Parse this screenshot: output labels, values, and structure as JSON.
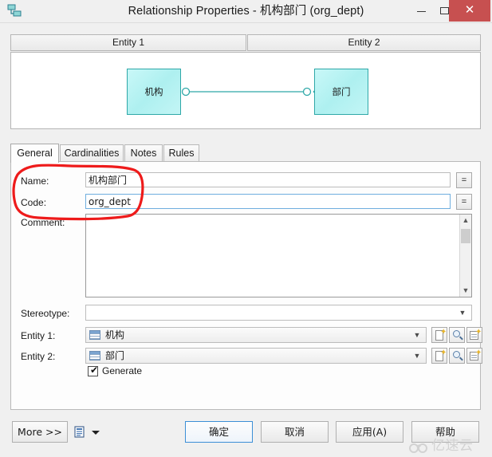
{
  "window": {
    "title": "Relationship Properties - 机构部门 (org_dept)",
    "app_icon": "relationship-icon",
    "minimize_label": "",
    "maximize_label": "",
    "close_label": "✕"
  },
  "preview": {
    "headers": [
      "Entity 1",
      "Entity 2"
    ],
    "entity1_label": "机构",
    "entity2_label": "部门",
    "entity_fill": "#aef0f0",
    "entity_border": "#2fa8a8",
    "link_color": "#2fa8a8"
  },
  "tabs": [
    {
      "label": "General",
      "active": true
    },
    {
      "label": "Cardinalities",
      "active": false
    },
    {
      "label": "Notes",
      "active": false
    },
    {
      "label": "Rules",
      "active": false
    }
  ],
  "form": {
    "name": {
      "label": "Name:",
      "value": "机构部门",
      "eq_label": "="
    },
    "code": {
      "label": "Code:",
      "value": "org_dept",
      "eq_label": "=",
      "focused": true
    },
    "comment": {
      "label": "Comment:",
      "value": ""
    },
    "stereotype": {
      "label": "Stereotype:",
      "value": ""
    },
    "entity1": {
      "label": "Entity 1:",
      "value": "机构"
    },
    "entity2": {
      "label": "Entity 2:",
      "value": "部门"
    },
    "generate": {
      "label": "Generate",
      "checked": true,
      "check_glyph": "✔"
    },
    "row_buttons": [
      "create-icon",
      "browse-icon",
      "properties-icon"
    ]
  },
  "footer": {
    "more_label": "More >>",
    "report_icon": "report-icon",
    "ok_label": "确定",
    "cancel_label": "取消",
    "apply_label": "应用(A)",
    "help_label": "帮助"
  },
  "annotation": {
    "color": "#ee1b1b",
    "shape": "hand-drawn-ellipse"
  },
  "watermark": {
    "text": "亿速云",
    "color": "#d2d2d2"
  }
}
